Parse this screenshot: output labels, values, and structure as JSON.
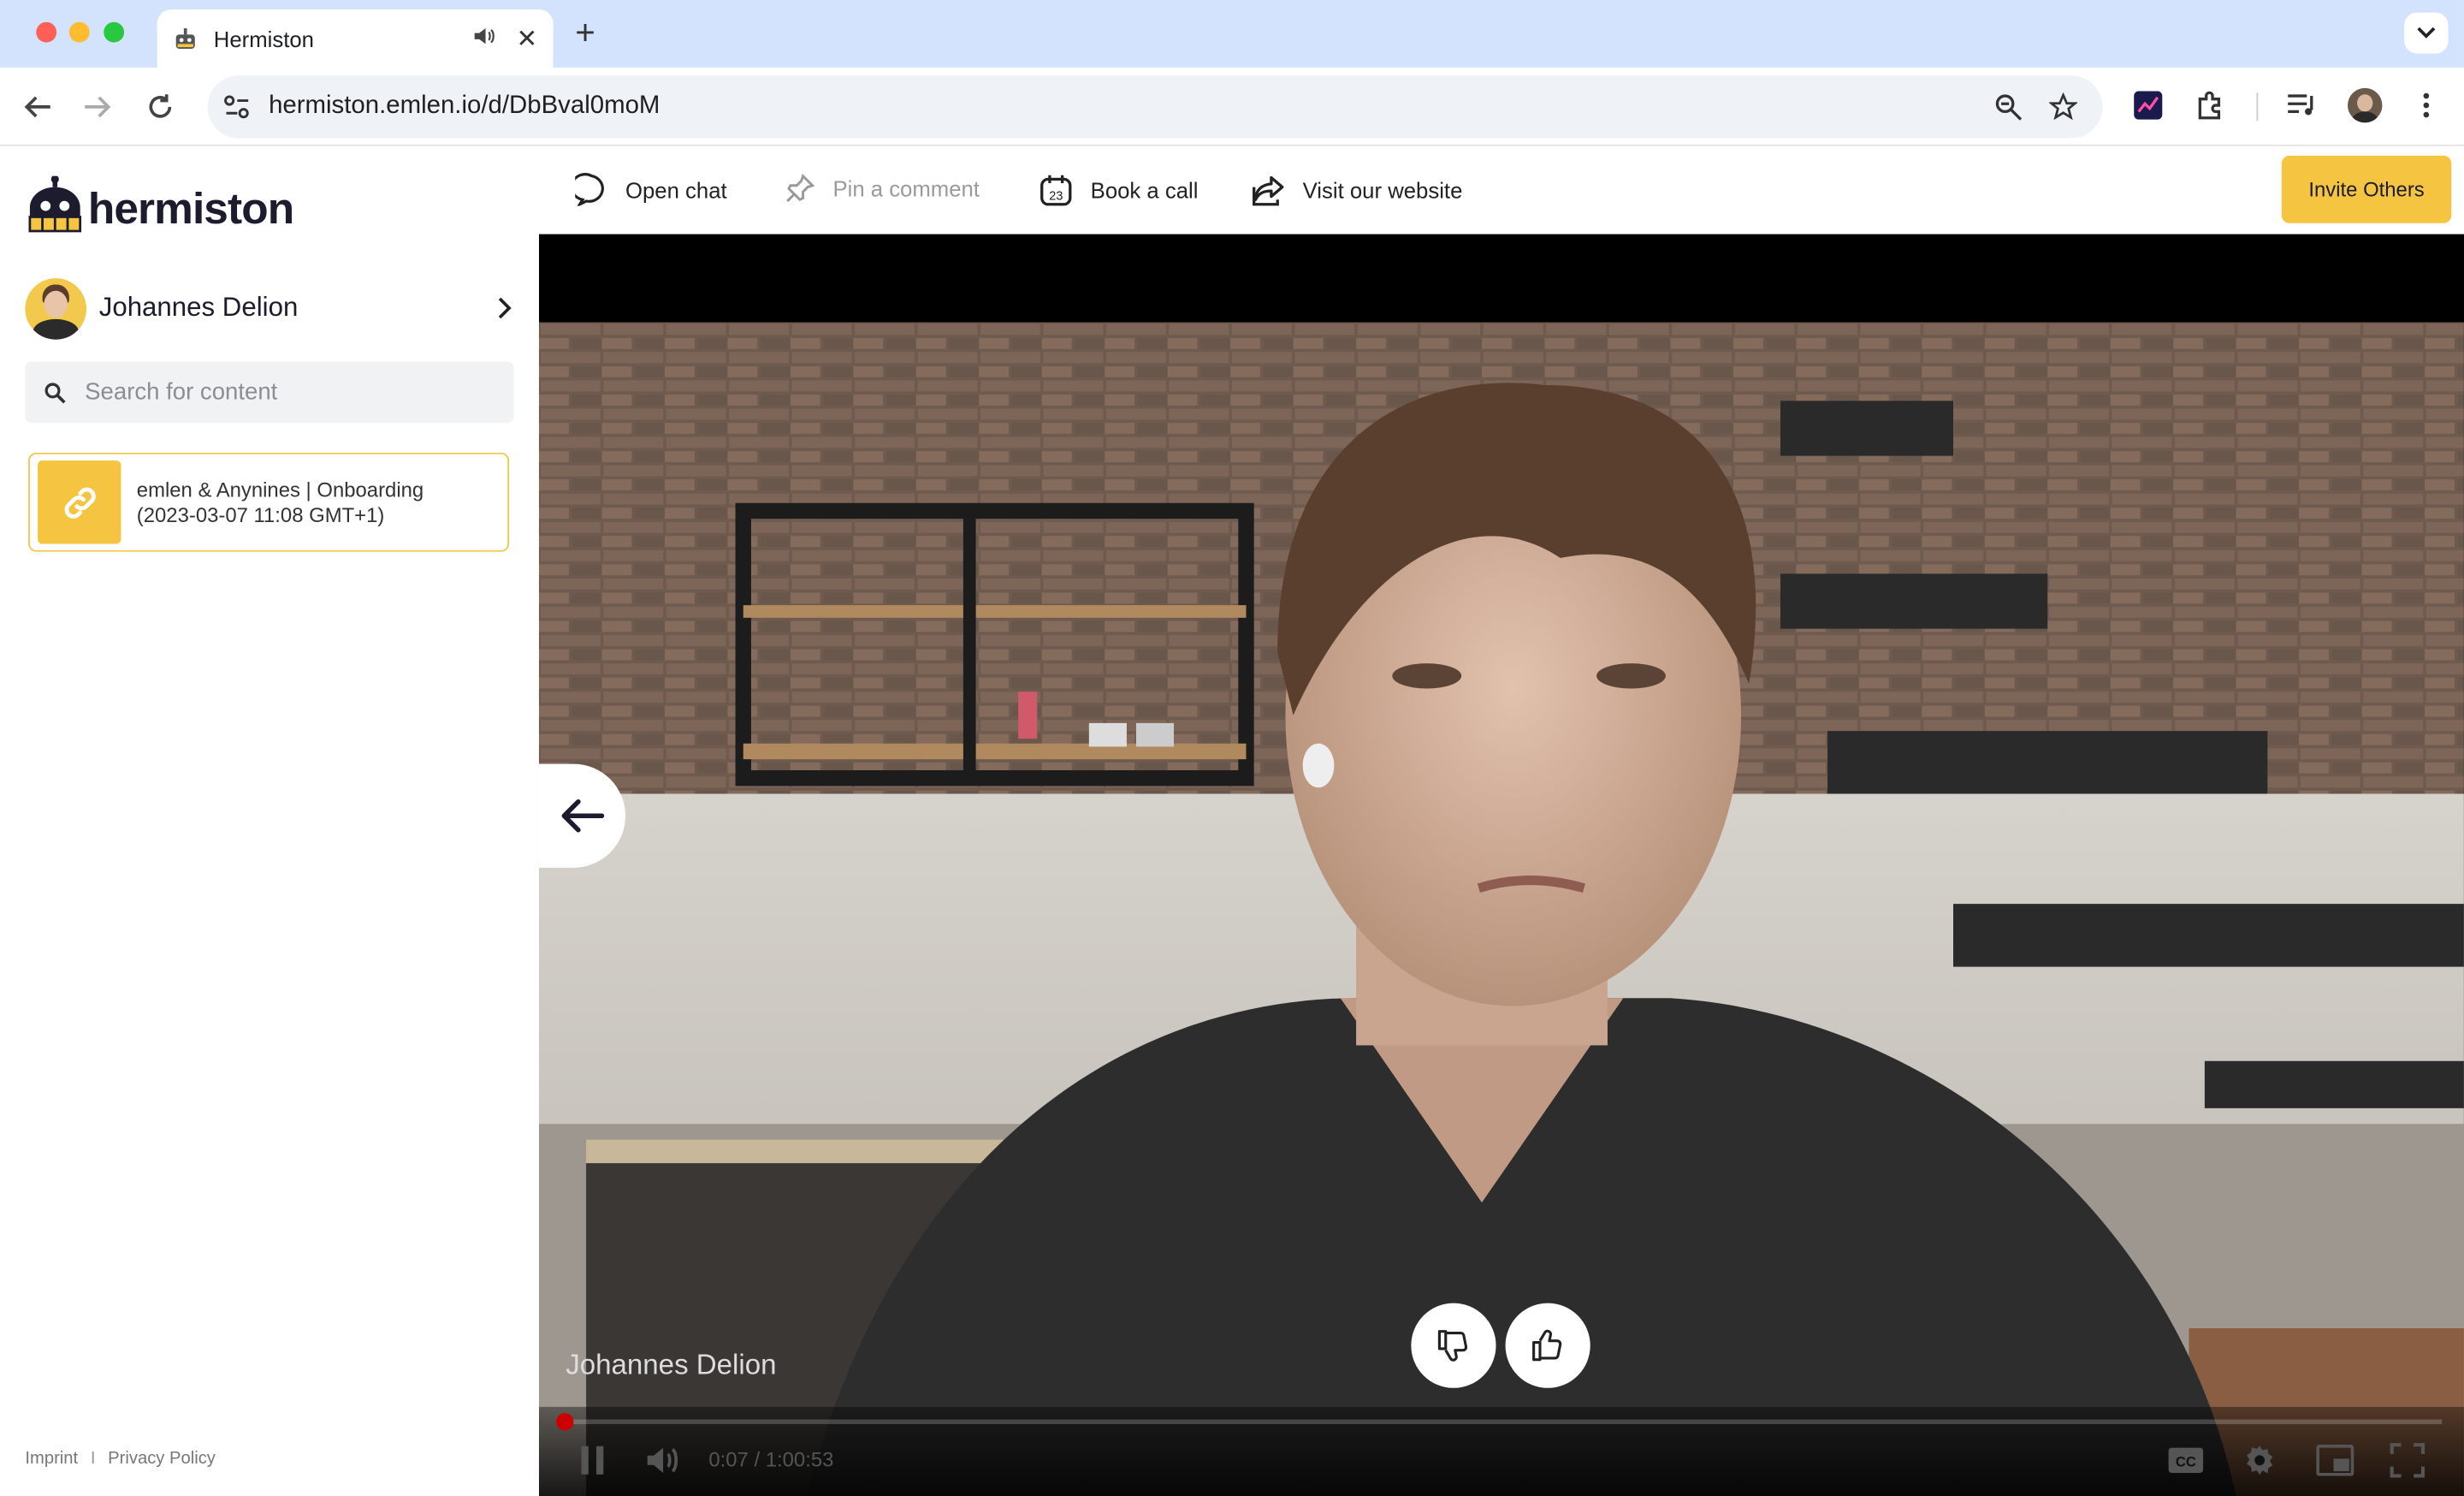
{
  "browser": {
    "tab_title": "Hermiston",
    "url": "hermiston.emlen.io/d/DbBval0moM"
  },
  "brand": {
    "name": "hermiston",
    "accent": "#f5c542"
  },
  "sidebar": {
    "user_name": "Johannes Delion",
    "search_placeholder": "Search for content",
    "items": [
      {
        "line1": "emlen & Anynines | Onboarding",
        "line2": "(2023-03-07 11:08 GMT+1)",
        "icon": "link-icon"
      }
    ],
    "footer": {
      "imprint": "Imprint",
      "separator": "I",
      "privacy": "Privacy Policy"
    }
  },
  "actions": {
    "open_chat": "Open chat",
    "pin_comment": "Pin a comment",
    "book_call": "Book a call",
    "calendar_day": "23",
    "visit_website": "Visit our website",
    "invite": "Invite Others"
  },
  "video": {
    "speaker_name": "Johannes Delion",
    "current_time": "0:07",
    "duration": "1:00:53",
    "time_display": "0:07 / 1:00:53",
    "progress_fraction": 0.002
  }
}
